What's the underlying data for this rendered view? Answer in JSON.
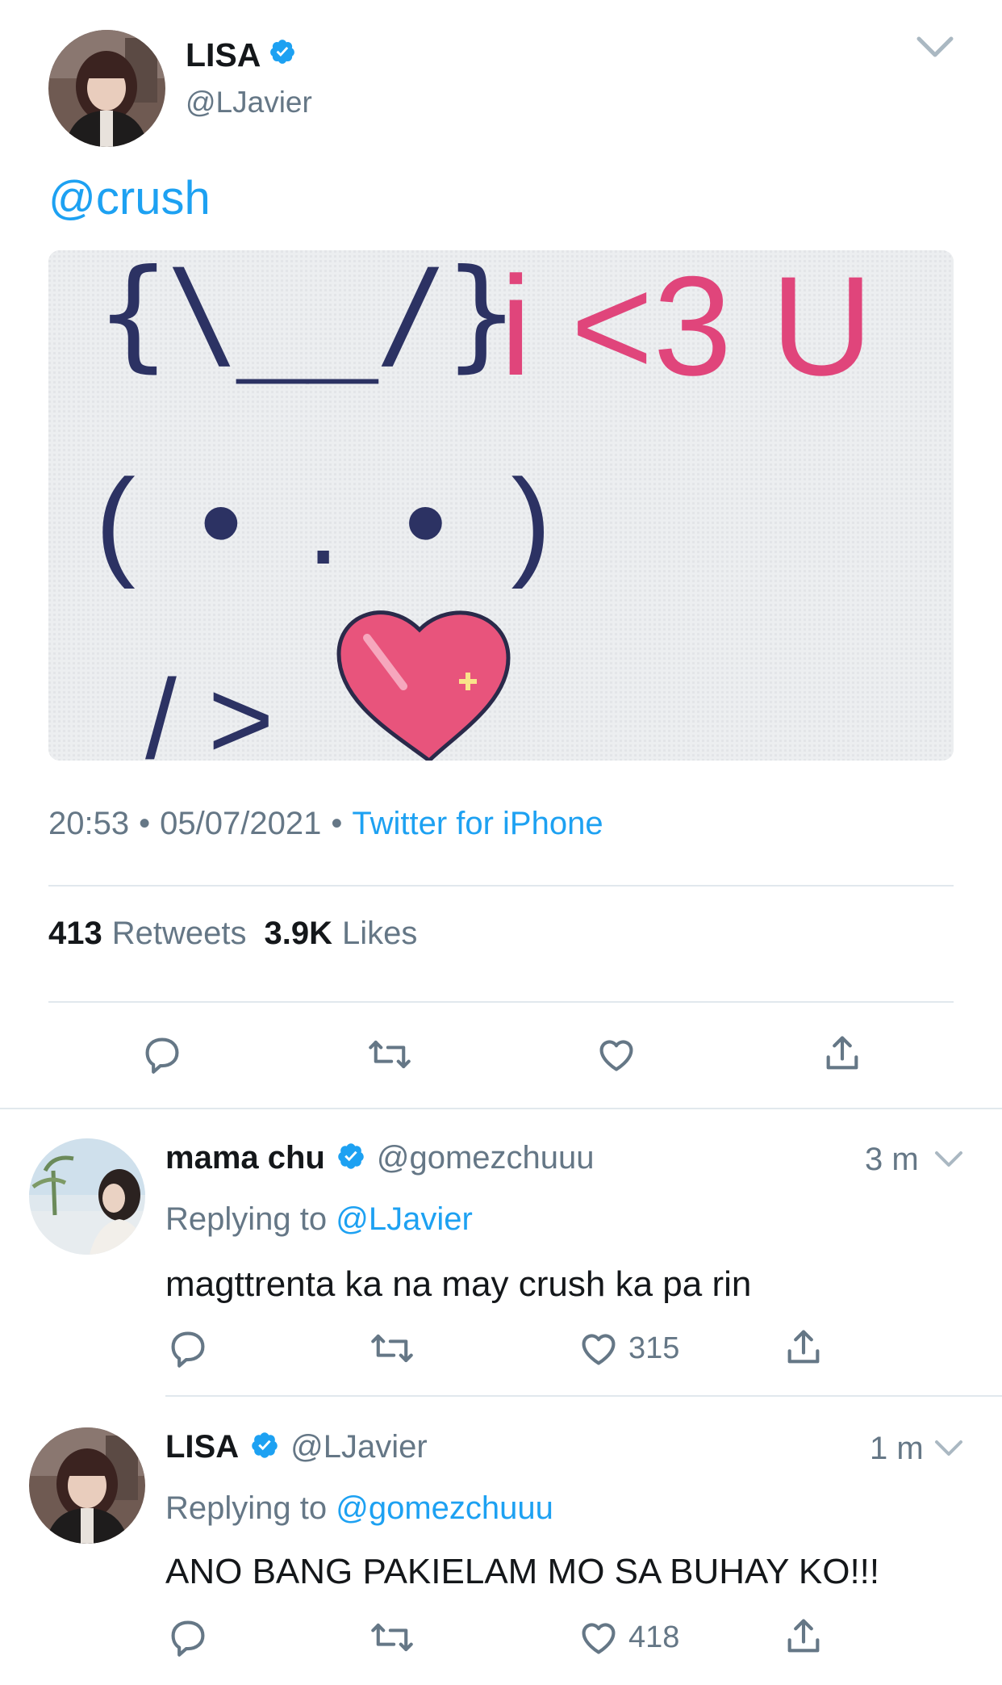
{
  "main_tweet": {
    "display_name": "LISA",
    "handle": "@LJavier",
    "mention": "@crush",
    "image_text": {
      "ears": "{\\__/}",
      "caption": "i <3 U",
      "face": "( • . • )",
      "hand": "/ >"
    },
    "time": "20:53",
    "sep1": "•",
    "date": "05/07/2021",
    "sep2": "•",
    "source": "Twitter for iPhone",
    "retweets_count": "413",
    "retweets_label": "Retweets",
    "likes_count": "3.9K",
    "likes_label": "Likes"
  },
  "replies": [
    {
      "display_name": "mama chu",
      "handle": "@gomezchuuu",
      "time": "3 m",
      "replying_prefix": "Replying to",
      "replying_to": "@LJavier",
      "text": "magttrenta ka na may crush ka pa rin",
      "likes": "315"
    },
    {
      "display_name": "LISA",
      "handle": "@LJavier",
      "time": "1 m",
      "replying_prefix": "Replying to",
      "replying_to": "@gomezchuuu",
      "text": "ANO BANG PAKIELAM MO SA BUHAY KO!!!",
      "likes": "418"
    }
  ],
  "colors": {
    "link_blue": "#1da1f2",
    "verified_blue": "#1da1f2",
    "gray_text": "#657786",
    "divider": "#e1e8ed",
    "pink_text": "#e0457b",
    "heart_pink": "#e8547c"
  },
  "icons": [
    "verified-badge-icon",
    "chevron-down-icon",
    "reply-icon",
    "retweet-icon",
    "like-icon",
    "share-icon"
  ]
}
